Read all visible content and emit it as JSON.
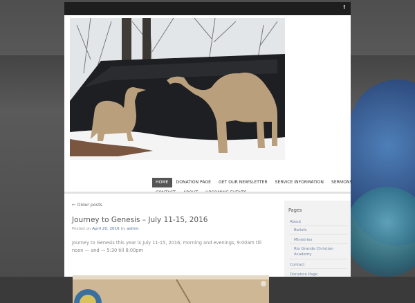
{
  "topbar": {
    "social_icon_label": "f"
  },
  "header": {
    "image_alt": "Camel cutouts in snow"
  },
  "nav": {
    "row1": [
      "HOME",
      "DONATION PAGE",
      "GET OUR NEWSLETTER",
      "SERVICE INFORMATION",
      "SERMONS"
    ],
    "row2": [
      "CONTACT",
      "ABOUT",
      "UPCOMING EVENTS"
    ]
  },
  "post": {
    "older_link": "← Older posts",
    "title": "Journey to Genesis – July 11-15, 2016",
    "meta_prefix": "Posted on",
    "date": "April 20, 2016",
    "meta_by": "by",
    "author": "admin",
    "excerpt": "Journey to Genesis this year is July 11-15, 2016, morning and evenings, 9:00am till noon — and — 5:30 till 8:00pm"
  },
  "sidebar": {
    "heading": "Pages",
    "items": [
      "About",
      "Beliefs",
      "Ministries",
      "Rio Grande Christian Academy",
      "Contact",
      "Donation Page"
    ]
  },
  "colors": {
    "nav_active_bg": "#555555",
    "link": "#4a6f9a",
    "camel": "#b99f7c"
  }
}
